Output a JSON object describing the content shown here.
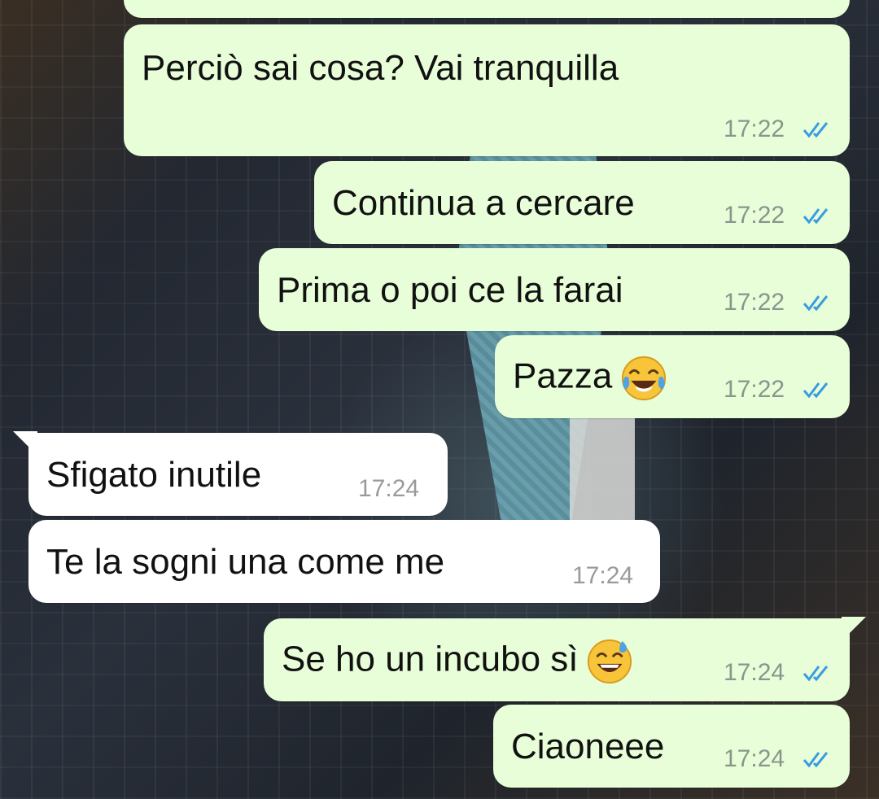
{
  "messages": [
    {
      "direction": "out",
      "text": "Perciò sai cosa? Vai tranquilla",
      "time": "17:22",
      "status": "read"
    },
    {
      "direction": "out",
      "text": "Continua a cercare",
      "time": "17:22",
      "status": "read"
    },
    {
      "direction": "out",
      "text": "Prima o poi ce la farai",
      "time": "17:22",
      "status": "read"
    },
    {
      "direction": "out",
      "text": "Pazza",
      "emoji": "face-with-tears-of-joy-icon",
      "time": "17:22",
      "status": "read"
    },
    {
      "direction": "in",
      "text": "Sfigato inutile",
      "time": "17:24"
    },
    {
      "direction": "in",
      "text": "Te la sogni una come me",
      "time": "17:24"
    },
    {
      "direction": "out",
      "text": "Se ho un incubo sì",
      "emoji": "grinning-face-with-sweat-icon",
      "time": "17:24",
      "status": "read"
    },
    {
      "direction": "out",
      "text": "Ciaoneee",
      "time": "17:24",
      "status": "read"
    }
  ],
  "colors": {
    "outgoing_bubble": "#e7fed8",
    "incoming_bubble": "#ffffff",
    "read_ticks": "#3a9be0",
    "timestamp": "#8a958c"
  }
}
